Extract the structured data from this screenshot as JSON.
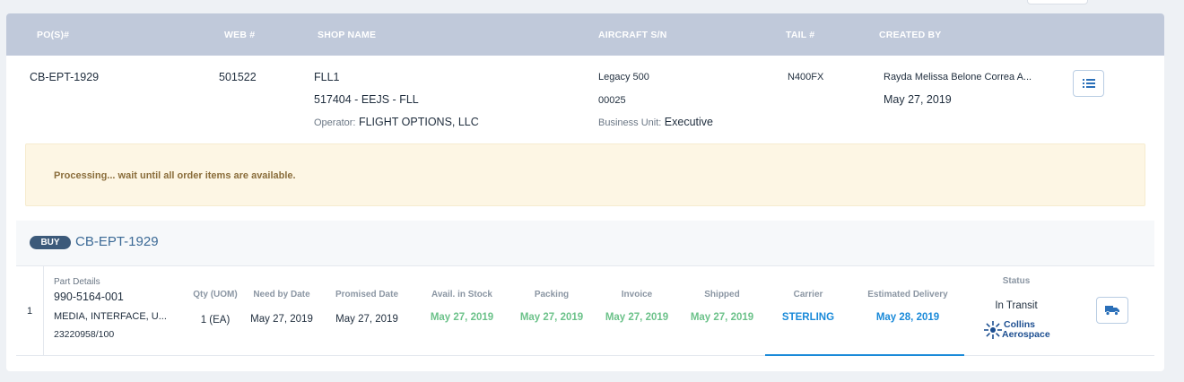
{
  "header": {
    "po": "PO(S)#",
    "web": "WEB #",
    "shop": "SHOP NAME",
    "aircraft": "AIRCRAFT S/N",
    "tail": "TAIL #",
    "created_by": "CREATED BY"
  },
  "order": {
    "po": "CB-EPT-1929",
    "web": "501522",
    "shop_name": "FLL1",
    "shop_address": "517404 - EEJS - FLL",
    "operator_label": "Operator:",
    "operator_value": "FLIGHT OPTIONS, LLC",
    "aircraft_model": "Legacy 500",
    "aircraft_serial": "00025",
    "business_unit_label": "Business Unit:",
    "business_unit_value": "Executive",
    "tail": "N400FX",
    "creator": "Rayda Melissa Belone Correa A...",
    "created_date": "May 27, 2019"
  },
  "notice": "Processing... wait until all order items are available.",
  "section": {
    "badge": "BUY",
    "po": "CB-EPT-1929"
  },
  "columns": {
    "qty": "Qty (UOM)",
    "need_by": "Need by Date",
    "promised": "Promised Date",
    "avail": "Avail. in Stock",
    "packing": "Packing",
    "invoice": "Invoice",
    "shipped": "Shipped",
    "carrier": "Carrier",
    "est_delivery": "Estimated Delivery",
    "status": "Status"
  },
  "item": {
    "index": "1",
    "part_details_label": "Part Details",
    "part_number": "990-5164-001",
    "description": "MEDIA, INTERFACE, U...",
    "ref": "23220958/100",
    "qty": "1 (EA)",
    "need_by": "May 27, 2019",
    "promised": "May 27, 2019",
    "avail": "May 27, 2019",
    "packing": "May 27, 2019",
    "invoice": "May 27, 2019",
    "shipped": "May 27, 2019",
    "carrier": "STERLING",
    "est_delivery": "May 28, 2019",
    "status": "In Transit",
    "logo_line1": "Collins",
    "logo_line2": "Aerospace"
  },
  "icons": {
    "details": "list-icon",
    "tracking": "truck-icon"
  },
  "colors": {
    "header_bg": "#c0c9da",
    "green": "#6cc28a",
    "blue": "#1a8ad9",
    "badge": "#3c5a7a",
    "notice_bg": "#fdf6e4"
  }
}
